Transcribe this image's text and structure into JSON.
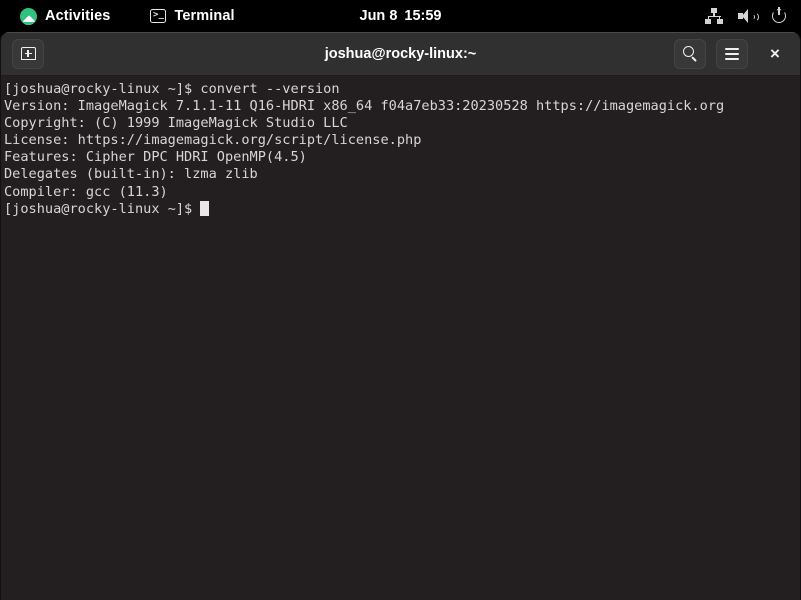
{
  "top_bar": {
    "activities": {
      "label": "Activities",
      "icon": "gnome-activities-icon"
    },
    "app": {
      "label": "Terminal",
      "icon": "terminal-icon"
    },
    "clock": {
      "date": "Jun 8",
      "time": "15:59"
    },
    "tray": {
      "network_icon": "wired-network-icon",
      "volume_icon": "volume-speaker-icon",
      "power_icon": "power-icon"
    },
    "background_color": "#000000"
  },
  "window": {
    "title": "joshua@rocky-linux:~",
    "header": {
      "new_tab_icon": "new-tab-icon",
      "search_icon": "search-icon",
      "menu_icon": "hamburger-menu-icon",
      "close_label": "×"
    },
    "colors": {
      "header_background": "#303030",
      "terminal_background": "#231f20",
      "terminal_foreground": "#d6d6d6"
    }
  },
  "terminal": {
    "lines": [
      "[joshua@rocky-linux ~]$ convert --version",
      "Version: ImageMagick 7.1.1-11 Q16-HDRI x86_64 f04a7eb33:20230528 https://imagemagick.org",
      "Copyright: (C) 1999 ImageMagick Studio LLC",
      "License: https://imagemagick.org/script/license.php",
      "Features: Cipher DPC HDRI OpenMP(4.5)",
      "Delegates (built-in): lzma zlib",
      "Compiler: gcc (11.3)"
    ],
    "prompt": "[joshua@rocky-linux ~]$ "
  }
}
